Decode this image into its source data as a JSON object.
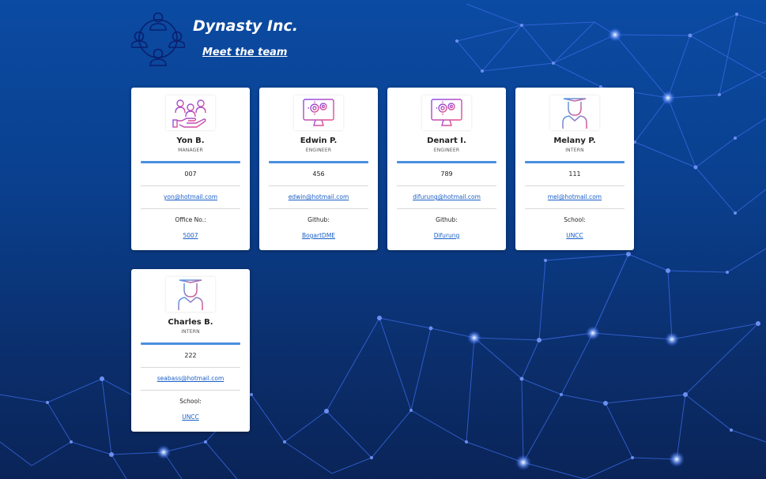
{
  "header": {
    "company_name": "Dynasty Inc.",
    "subtitle_link": "Meet the team",
    "logo_icon": "team-people-icon"
  },
  "colors": {
    "background_top": "#0b4ba3",
    "background_bottom": "#0a2458",
    "accent_bar": "#4a8fe0",
    "link": "#1a5fc8",
    "network_line": "#3b6be8"
  },
  "cards": [
    {
      "name": "Yon B.",
      "role": "MANAGER",
      "id": "007",
      "email": "yon@hotmail.com",
      "extra_label": "Office No.:",
      "extra_value": "5007",
      "icon": "team-handshake-icon"
    },
    {
      "name": "Edwin P.",
      "role": "ENGINEER",
      "id": "456",
      "email": "edwin@hotmail.com",
      "extra_label": "Github:",
      "extra_value": "BogartDME",
      "icon": "monitor-gears-icon"
    },
    {
      "name": "Denart I.",
      "role": "ENGINEER",
      "id": "789",
      "email": "difurung@hotmail.com",
      "extra_label": "Github:",
      "extra_value": "Difurung",
      "icon": "monitor-gears-icon"
    },
    {
      "name": "Melany P.",
      "role": "INTERN",
      "id": "111",
      "email": "mel@hotmail.com",
      "extra_label": "School:",
      "extra_value": "UNCC",
      "icon": "graduate-icon"
    },
    {
      "name": "Charles B.",
      "role": "INTERN",
      "id": "222",
      "email": "seabass@hotmail.com",
      "extra_label": "School:",
      "extra_value": "UNCC",
      "icon": "graduate-icon"
    }
  ]
}
